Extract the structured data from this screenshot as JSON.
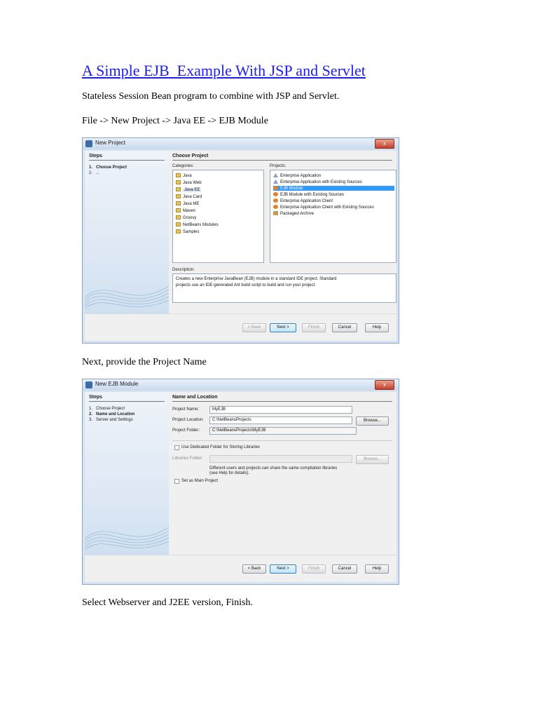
{
  "title": "A Simple EJB  Example With JSP and Servlet",
  "paragraphs": {
    "intro": "Stateless Session Bean program to combine with JSP and Servlet.",
    "path": "File -> New Project -> Java EE -> EJB Module",
    "next": "Next, provide the Project Name",
    "final": "Select Webserver and J2EE version, Finish."
  },
  "dialog1": {
    "title": "New Project",
    "close": "x",
    "steps_header": "Steps",
    "steps": [
      "1.   Choose Project",
      "2.   ..."
    ],
    "panel_header": "Choose Project",
    "categories_label": "Categories:",
    "categories": [
      "Java",
      "Java Web",
      "Java EE",
      "Java Card",
      "Java ME",
      "Maven",
      "Groovy",
      "NetBeans Modules",
      "Samples"
    ],
    "selected_category": "Java EE",
    "projects_label": "Projects:",
    "projects": [
      {
        "label": "Enterprise Application",
        "icon": "enterprise-icon"
      },
      {
        "label": "Enterprise Application with Existing Sources",
        "icon": "enterprise-icon"
      },
      {
        "label": "EJB Module",
        "icon": "bean-icon"
      },
      {
        "label": "EJB Module with Existing Sources",
        "icon": "bean-icon"
      },
      {
        "label": "Enterprise Application Client",
        "icon": "bean-icon"
      },
      {
        "label": "Enterprise Application Client with Existing Sources",
        "icon": "bean-icon"
      },
      {
        "label": "Packaged Archive",
        "icon": "archive-icon"
      }
    ],
    "selected_project": "EJB Module",
    "description_label": "Description:",
    "description_1": "Creates a new Enterprise JavaBean (EJB) module in a standard IDE project. Standard",
    "description_2": "projects use an IDE-generated Ant build script to build and run your project.",
    "buttons": {
      "back": "< Back",
      "next": "Next >",
      "finish": "Finish",
      "cancel": "Cancel",
      "help": "Help"
    }
  },
  "dialog2": {
    "title": "New EJB Module",
    "close": "x",
    "steps_header": "Steps",
    "steps": [
      "1.   Choose Project",
      "2.   Name and Location",
      "3.   Server and Settings"
    ],
    "panel_header": "Name and Location",
    "project_name_label": "Project Name:",
    "project_name": "MyEJB",
    "project_location_label": "Project Location:",
    "project_location": "C:\\NetBeansProjects",
    "project_folder_label": "Project Folder:",
    "project_folder": "C:\\NetBeansProjects\\MyEJB",
    "browse": "Browse...",
    "dedicated_folder_label": "Use Dedicated Folder for Storing Libraries",
    "libraries_folder_label": "Libraries Folder:",
    "libraries_note_1": "Different users and projects can share the same compilation libraries",
    "libraries_note_2": "(see Help for details).",
    "main_project_label": "Set as Main Project",
    "buttons": {
      "back": "< Back",
      "next": "Next >",
      "finish": "Finish",
      "cancel": "Cancel",
      "help": "Help"
    }
  },
  "colors": {
    "title_link": "#1d1df0",
    "selection": "#3399ff",
    "dialog_frame": "#d6e4f2"
  }
}
